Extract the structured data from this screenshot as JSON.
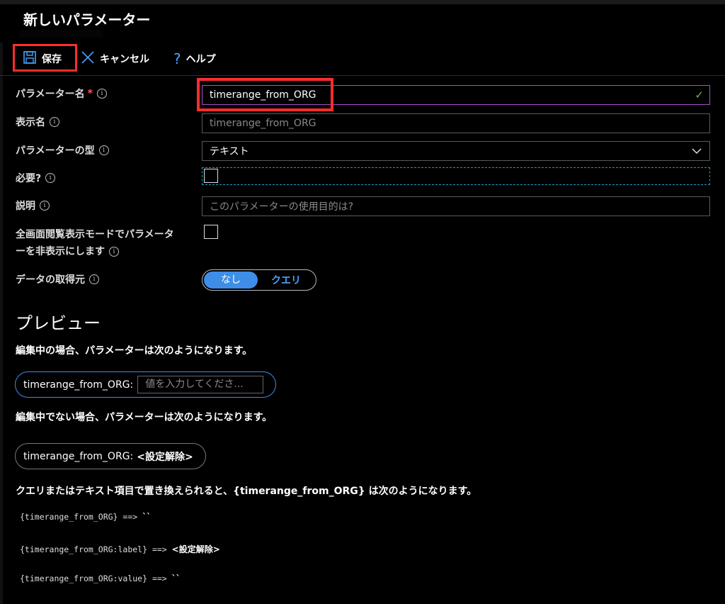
{
  "panel": {
    "title": "新しいパラメーター"
  },
  "toolbar": {
    "save_label": "保存",
    "cancel_label": "キャンセル",
    "help_label": "ヘルプ"
  },
  "form": {
    "param_name": {
      "label": "パラメーター名",
      "required_mark": "*",
      "value": "timerange_from_ORG"
    },
    "display_name": {
      "label": "表示名",
      "placeholder": "timerange_from_ORG"
    },
    "param_type": {
      "label": "パラメーターの型",
      "selected": "テキスト"
    },
    "required": {
      "label": "必要?",
      "checked": false
    },
    "description": {
      "label": "説明",
      "placeholder": "このパラメーターの使用目的は?"
    },
    "hide_in_view": {
      "label_line1": "全画面閲覧表示モードでパラメータ",
      "label_line2": "ーを非表示にします",
      "checked": false
    },
    "data_source": {
      "label": "データの取得元",
      "options": [
        "なし",
        "クエリ"
      ],
      "selected": "なし"
    }
  },
  "preview": {
    "heading": "プレビュー",
    "editing_desc": "編集中の場合、パラメーターは次のようになります。",
    "editing_label": "timerange_from_ORG:",
    "editing_placeholder": "値を入力してくださ...",
    "not_editing_desc": "編集中でない場合、パラメーターは次のようになります。",
    "not_editing_label": "timerange_from_ORG:",
    "not_editing_value": "<設定解除>",
    "replace_desc": "クエリまたはテキスト項目で置き換えられると、{timerange_from_ORG} は次のようになります。",
    "replacements": [
      {
        "token": "{timerange_from_ORG}",
        "arrow": " ==> ",
        "result": "``"
      },
      {
        "token": "{timerange_from_ORG:label}",
        "arrow": " ==> ",
        "result": "<設定解除>"
      },
      {
        "token": "{timerange_from_ORG:value}",
        "arrow": " ==> ",
        "result": "``"
      }
    ]
  },
  "colors": {
    "accent": "#3e8ee8",
    "highlight_red": "#ff2d2d",
    "valid_green": "#6cc04a",
    "focus_purple": "#a64fc9"
  },
  "icons": {
    "save": "floppy-disk-icon",
    "cancel": "close-icon",
    "help": "question-icon",
    "info": "info-icon",
    "valid": "checkmark-icon",
    "dropdown": "chevron-down-icon"
  }
}
